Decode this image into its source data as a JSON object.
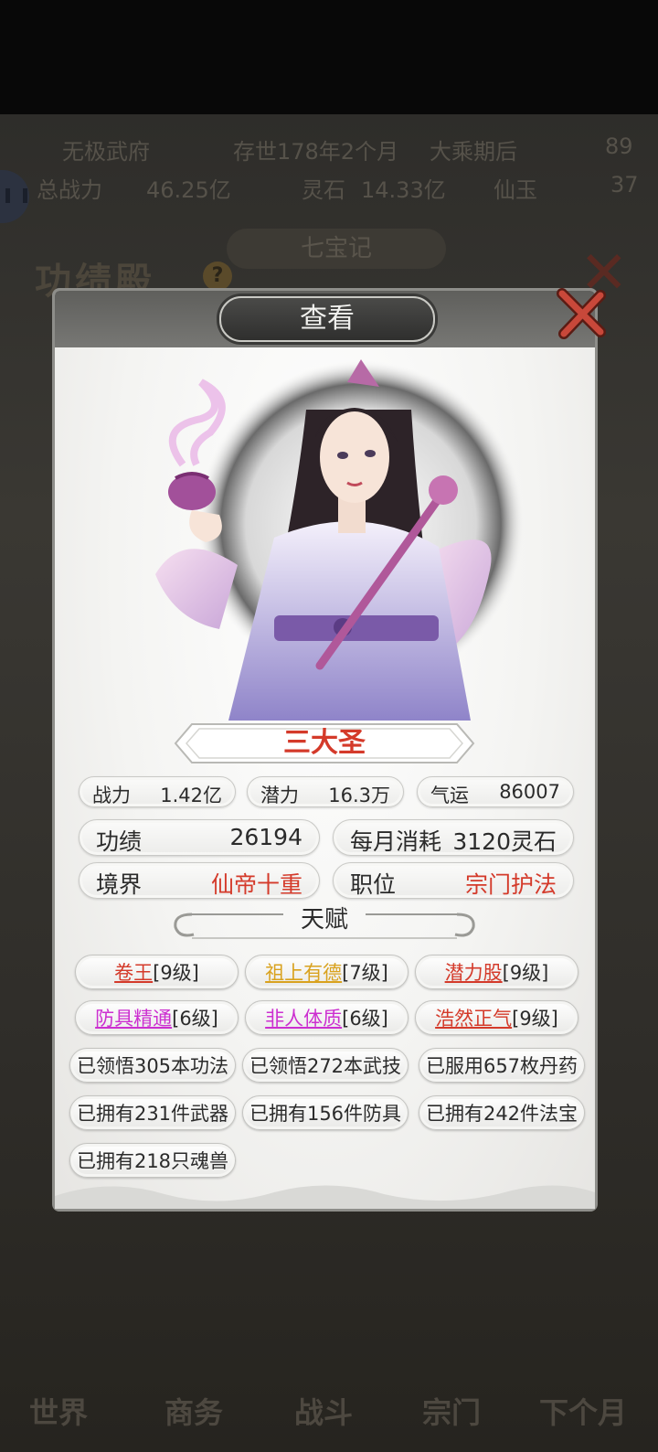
{
  "background": {
    "status_row1": [
      "无极武府",
      "存世178年2个月",
      "大乘期后",
      "89"
    ],
    "status_row2": [
      "总战力",
      "46.25亿",
      "灵石",
      "14.33亿",
      "仙玉",
      "37"
    ],
    "hall_title": "功绩殿",
    "help_icon": "?",
    "tab_label": "七宝记",
    "bottom_nav": [
      "世界",
      "商务",
      "战斗",
      "宗门",
      "下个月"
    ]
  },
  "modal": {
    "title": "查看",
    "close_icon": "close-x-icon",
    "character": {
      "name": "三大圣",
      "stats_small": [
        {
          "label": "战力",
          "value": "1.42亿"
        },
        {
          "label": "潜力",
          "value": "16.3万"
        },
        {
          "label": "气运",
          "value": "86007"
        }
      ],
      "merit": {
        "label": "功绩",
        "value": "26194"
      },
      "monthly_cost": {
        "label": "每月消耗",
        "value": "3120灵石"
      },
      "realm": {
        "label": "境界",
        "value": "仙帝十重"
      },
      "position": {
        "label": "职位",
        "value": "宗门护法"
      }
    },
    "talent_title": "天赋",
    "talents": [
      {
        "name": "卷王",
        "level": "[9级]",
        "color": "#d43a2a"
      },
      {
        "name": "祖上有德",
        "level": "[7级]",
        "color": "#d9a21e"
      },
      {
        "name": "潜力股",
        "level": "[9级]",
        "color": "#d43a2a"
      },
      {
        "name": "防具精通",
        "level": "[6级]",
        "color": "#cc2fd0"
      },
      {
        "name": "非人体质",
        "level": "[6级]",
        "color": "#cc2fd0"
      },
      {
        "name": "浩然正气",
        "level": "[9级]",
        "color": "#d43a2a"
      }
    ],
    "records": [
      "已领悟305本功法",
      "已领悟272本武技",
      "已服用657枚丹药",
      "已拥有231件武器",
      "已拥有156件防具",
      "已拥有242件法宝",
      "已拥有218只魂兽"
    ]
  }
}
